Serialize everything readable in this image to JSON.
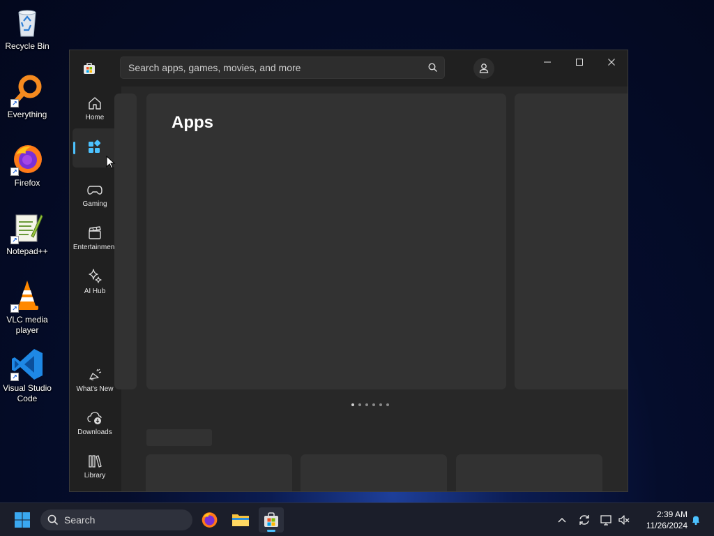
{
  "desktop": {
    "icons": [
      {
        "label": "Recycle Bin",
        "icon": "recycle-bin-icon"
      },
      {
        "label": "Everything",
        "icon": "everything-search-icon"
      },
      {
        "label": "Firefox",
        "icon": "firefox-icon"
      },
      {
        "label": "Notepad++",
        "icon": "notepadpp-icon"
      },
      {
        "label": "VLC media\nplayer",
        "icon": "vlc-icon"
      },
      {
        "label": "Visual Studio\nCode",
        "icon": "vscode-icon"
      }
    ]
  },
  "store": {
    "search_placeholder": "Search apps, games, movies, and more",
    "nav": [
      {
        "label": "Home",
        "icon": "home-icon"
      },
      {
        "label": "",
        "icon": "apps-icon",
        "active": true
      },
      {
        "label": "Gaming",
        "icon": "gamepad-icon"
      },
      {
        "label": "Entertainment",
        "icon": "clapperboard-icon"
      },
      {
        "label": "AI Hub",
        "icon": "sparkle-icon"
      },
      {
        "label": "What's New",
        "icon": "megaphone-icon"
      },
      {
        "label": "Downloads",
        "icon": "cloud-download-icon"
      },
      {
        "label": "Library",
        "icon": "library-icon"
      }
    ],
    "hero_title": "Apps",
    "carousel_dots": 6,
    "carousel_active": 0,
    "accent_color": "#4cc2ff"
  },
  "taskbar": {
    "search_label": "Search",
    "time": "2:39 AM",
    "date": "11/26/2024"
  }
}
